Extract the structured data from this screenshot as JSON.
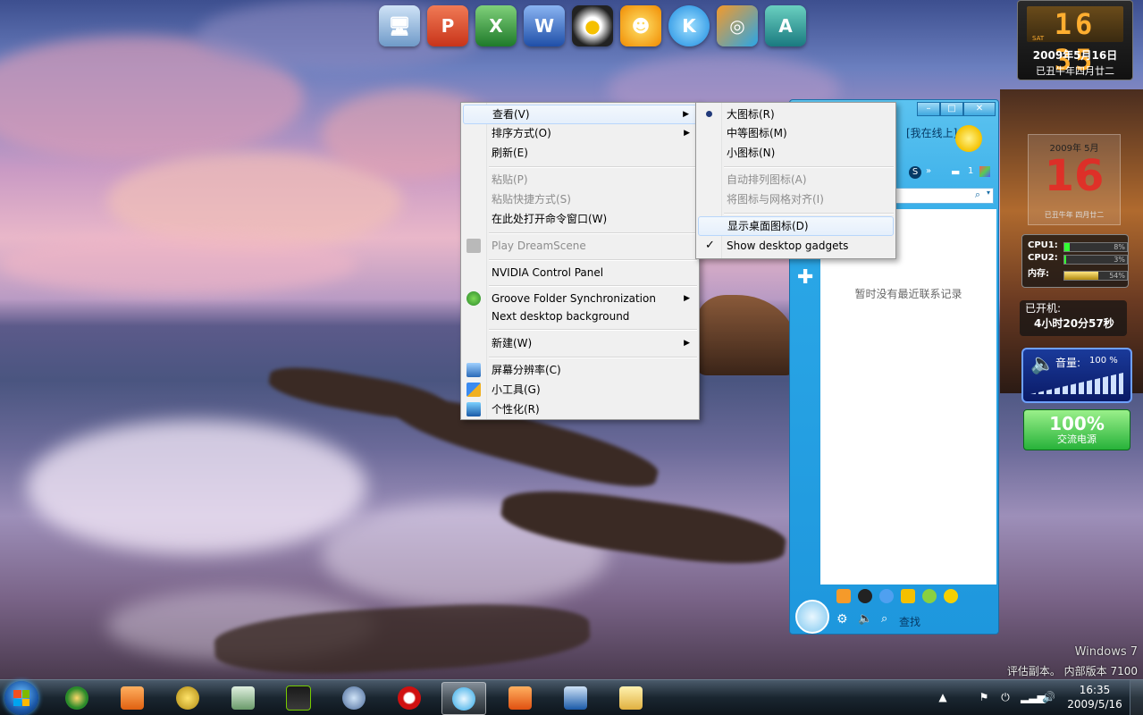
{
  "context_menu": {
    "items": [
      {
        "label": "查看(V)",
        "submenu": true
      },
      {
        "label": "排序方式(O)",
        "submenu": true
      },
      {
        "label": "刷新(E)"
      },
      {
        "label": "粘贴(P)",
        "disabled": true
      },
      {
        "label": "粘贴快捷方式(S)",
        "disabled": true
      },
      {
        "label": "在此处打开命令窗口(W)"
      },
      {
        "label": "Play DreamScene",
        "disabled": true
      },
      {
        "label": "NVIDIA Control Panel"
      },
      {
        "label": "Groove Folder Synchronization",
        "submenu": true
      },
      {
        "label": "Next desktop background"
      },
      {
        "label": "新建(W)",
        "submenu": true
      },
      {
        "label": "屏幕分辨率(C)"
      },
      {
        "label": "小工具(G)"
      },
      {
        "label": "个性化(R)"
      }
    ]
  },
  "view_submenu": {
    "items": [
      {
        "label": "大图标(R)",
        "selected": true
      },
      {
        "label": "中等图标(M)"
      },
      {
        "label": "小图标(N)"
      },
      {
        "label": "自动排列图标(A)",
        "disabled": true
      },
      {
        "label": "将图标与网格对齐(I)",
        "disabled": true
      },
      {
        "label": "显示桌面图标(D)",
        "highlighted": true
      },
      {
        "label": "Show desktop gadgets",
        "checked": true
      }
    ]
  },
  "qq": {
    "status": "[我在线上]",
    "empty_text": "暂时没有最近联系记录",
    "find": "查找",
    "message_count": "1"
  },
  "gadgets": {
    "clock_time": "16 35",
    "clock_day_abbr": "SAT",
    "date": "2009年5月16日",
    "lunar": "已丑牛年四月廿二",
    "cal_head": "2009年  5月",
    "cal_day": "16",
    "cal_foot": "已丑牛年  四月廿二",
    "cpu1_label": "CPU1:",
    "cpu1_pct": "8%",
    "cpu1_value": 0.08,
    "cpu2_label": "CPU2:",
    "cpu2_pct": "3%",
    "cpu2_value": 0.03,
    "mem_label": "内存:",
    "mem_pct": "54%",
    "mem_value": 0.54,
    "uptime_label": "已开机:",
    "uptime_value": "4小时20分57秒",
    "volume_label": "音量:",
    "volume_value": "100  %",
    "power_pct": "100%",
    "power_label": "交流电源"
  },
  "watermark": {
    "line1": "Windows 7",
    "line2": "评估副本。 内部版本 7100"
  },
  "taskbar": {
    "time": "16:35",
    "date": "2009/5/16"
  },
  "colors": {
    "menu_bg": "#f0f0f0",
    "qq_blue": "#2aa6e6",
    "cal_red": "#e22222"
  }
}
